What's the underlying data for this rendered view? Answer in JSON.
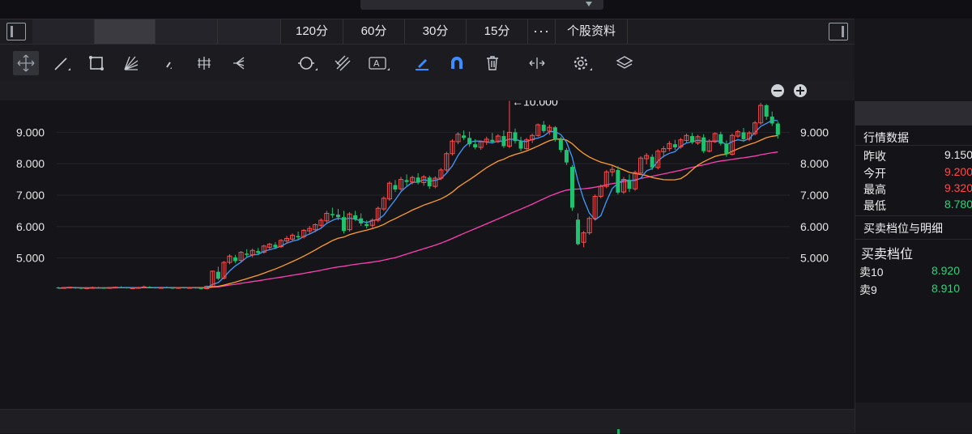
{
  "periods": {
    "p120": "120分",
    "p60": "60分",
    "p30": "30分",
    "p15": "15分",
    "more": "···",
    "profile": "个股资料"
  },
  "toolbar": {
    "tools": [
      "crosshair-icon",
      "line-icon",
      "rectangle-icon",
      "fan-icon",
      "arrow-icon",
      "channel-icon",
      "fib-icon",
      "cycle-icon",
      "pitchfork-icon",
      "text-icon",
      "pen-icon",
      "magnet-icon",
      "trash-icon",
      "measure-icon",
      "settings-icon",
      "layers-icon"
    ]
  },
  "chart_data": {
    "type": "candlestick",
    "y_ticks": [
      "9.000",
      "8.000",
      "7.000",
      "6.000",
      "5.000"
    ],
    "ylim": [
      4.0,
      10.0
    ],
    "annotation": "←10.000",
    "colors": {
      "up": "#ff4d4d",
      "down": "#1fc26e",
      "ma5": "#3f9cff",
      "ma20": "#ff9e2b",
      "ma60": "#ff3fb5"
    },
    "candles": [
      [
        4.06,
        4.08,
        4.02,
        4.04
      ],
      [
        4.05,
        4.07,
        4.02,
        4.06
      ],
      [
        4.05,
        4.08,
        4.03,
        4.07
      ],
      [
        4.06,
        4.08,
        4.02,
        4.04
      ],
      [
        4.05,
        4.06,
        4.01,
        4.03
      ],
      [
        4.04,
        4.07,
        4.02,
        4.05
      ],
      [
        4.05,
        4.09,
        4.03,
        4.06
      ],
      [
        4.06,
        4.08,
        4.03,
        4.05
      ],
      [
        4.05,
        4.07,
        4.02,
        4.04
      ],
      [
        4.04,
        4.07,
        4.02,
        4.06
      ],
      [
        4.06,
        4.09,
        4.04,
        4.07
      ],
      [
        4.07,
        4.1,
        4.04,
        4.06
      ],
      [
        4.06,
        4.08,
        4.03,
        4.05
      ],
      [
        4.05,
        4.07,
        4.02,
        4.05
      ],
      [
        4.05,
        4.08,
        4.03,
        4.06
      ],
      [
        4.06,
        4.12,
        4.04,
        4.08
      ],
      [
        4.08,
        4.1,
        4.04,
        4.06
      ],
      [
        4.06,
        4.08,
        4.03,
        4.05
      ],
      [
        4.05,
        4.08,
        4.03,
        4.06
      ],
      [
        4.06,
        4.09,
        4.04,
        4.05
      ],
      [
        4.05,
        4.07,
        4.02,
        4.04
      ],
      [
        4.04,
        4.07,
        4.02,
        4.06
      ],
      [
        4.06,
        4.08,
        4.03,
        4.05
      ],
      [
        4.05,
        4.08,
        4.03,
        4.06
      ],
      [
        4.06,
        4.08,
        4.03,
        4.04
      ],
      [
        4.04,
        4.06,
        4.0,
        4.02
      ],
      [
        4.02,
        4.12,
        4.0,
        4.1
      ],
      [
        4.1,
        4.6,
        4.08,
        4.58
      ],
      [
        4.56,
        4.72,
        4.3,
        4.34
      ],
      [
        4.36,
        4.9,
        4.32,
        4.86
      ],
      [
        4.86,
        5.12,
        4.8,
        5.06
      ],
      [
        5.02,
        5.1,
        4.84,
        4.9
      ],
      [
        4.92,
        5.22,
        4.88,
        5.18
      ],
      [
        5.14,
        5.28,
        5.02,
        5.1
      ],
      [
        5.1,
        5.3,
        5.02,
        5.24
      ],
      [
        5.22,
        5.32,
        5.1,
        5.16
      ],
      [
        5.18,
        5.42,
        5.14,
        5.38
      ],
      [
        5.34,
        5.48,
        5.26,
        5.44
      ],
      [
        5.42,
        5.5,
        5.28,
        5.34
      ],
      [
        5.36,
        5.6,
        5.32,
        5.56
      ],
      [
        5.54,
        5.7,
        5.46,
        5.62
      ],
      [
        5.6,
        5.78,
        5.54,
        5.72
      ],
      [
        5.7,
        5.84,
        5.58,
        5.66
      ],
      [
        5.68,
        5.92,
        5.62,
        5.88
      ],
      [
        5.86,
        6.02,
        5.78,
        5.94
      ],
      [
        5.9,
        6.1,
        5.82,
        6.06
      ],
      [
        6.04,
        6.26,
        5.98,
        6.2
      ],
      [
        6.18,
        6.5,
        6.1,
        6.42
      ],
      [
        6.4,
        6.6,
        6.28,
        6.36
      ],
      [
        6.38,
        6.56,
        6.2,
        6.3
      ],
      [
        6.3,
        6.5,
        5.78,
        5.86
      ],
      [
        5.9,
        6.46,
        5.84,
        6.4
      ],
      [
        6.36,
        6.5,
        6.18,
        6.24
      ],
      [
        6.26,
        6.42,
        6.02,
        6.1
      ],
      [
        6.08,
        6.2,
        5.94,
        6.02
      ],
      [
        6.04,
        6.26,
        5.96,
        6.2
      ],
      [
        6.2,
        6.64,
        6.14,
        6.58
      ],
      [
        6.56,
        6.96,
        6.5,
        6.9
      ],
      [
        6.88,
        7.44,
        6.82,
        7.38
      ],
      [
        7.32,
        7.48,
        7.1,
        7.18
      ],
      [
        7.2,
        7.58,
        7.14,
        7.5
      ],
      [
        7.48,
        7.66,
        7.3,
        7.42
      ],
      [
        7.42,
        7.62,
        7.34,
        7.56
      ],
      [
        7.56,
        7.7,
        7.34,
        7.4
      ],
      [
        7.4,
        7.64,
        7.3,
        7.58
      ],
      [
        7.56,
        7.62,
        7.2,
        7.28
      ],
      [
        7.28,
        7.6,
        7.22,
        7.54
      ],
      [
        7.54,
        7.86,
        7.48,
        7.8
      ],
      [
        7.8,
        8.38,
        7.74,
        8.32
      ],
      [
        8.32,
        8.78,
        8.26,
        8.72
      ],
      [
        8.7,
        9.0,
        8.62,
        8.94
      ],
      [
        8.9,
        9.06,
        8.76,
        8.82
      ],
      [
        8.82,
        9.02,
        8.54,
        8.62
      ],
      [
        8.62,
        8.78,
        8.46,
        8.52
      ],
      [
        8.52,
        8.74,
        8.44,
        8.7
      ],
      [
        8.7,
        8.86,
        8.6,
        8.78
      ],
      [
        8.76,
        8.98,
        8.64,
        8.7
      ],
      [
        8.7,
        8.94,
        8.66,
        8.88
      ],
      [
        8.88,
        9.06,
        8.5,
        8.56
      ],
      [
        8.56,
        10.0,
        8.5,
        9.0
      ],
      [
        9.0,
        9.12,
        8.64,
        8.72
      ],
      [
        8.72,
        8.86,
        8.4,
        8.48
      ],
      [
        8.48,
        8.82,
        8.44,
        8.76
      ],
      [
        8.76,
        8.96,
        8.66,
        8.9
      ],
      [
        8.9,
        9.28,
        8.86,
        9.24
      ],
      [
        9.24,
        9.36,
        8.98,
        9.04
      ],
      [
        9.04,
        9.24,
        8.92,
        9.16
      ],
      [
        9.16,
        9.2,
        8.7,
        8.76
      ],
      [
        8.76,
        8.86,
        8.36,
        8.44
      ],
      [
        8.44,
        8.5,
        7.96,
        8.04
      ],
      [
        7.9,
        7.96,
        6.5,
        6.6
      ],
      [
        6.22,
        6.42,
        5.4,
        5.44
      ],
      [
        5.5,
        5.86,
        5.34,
        5.8
      ],
      [
        5.8,
        6.32,
        5.74,
        6.26
      ],
      [
        6.26,
        7.02,
        6.2,
        6.96
      ],
      [
        6.96,
        7.34,
        6.9,
        7.28
      ],
      [
        7.28,
        7.8,
        7.22,
        7.74
      ],
      [
        7.74,
        7.92,
        7.6,
        7.82
      ],
      [
        7.8,
        7.92,
        7.02,
        7.08
      ],
      [
        7.1,
        7.58,
        7.04,
        7.5
      ],
      [
        7.48,
        7.66,
        7.1,
        7.2
      ],
      [
        7.2,
        7.78,
        7.14,
        7.72
      ],
      [
        7.7,
        8.24,
        7.64,
        8.18
      ],
      [
        8.16,
        8.34,
        7.98,
        8.26
      ],
      [
        8.22,
        8.3,
        7.8,
        7.88
      ],
      [
        7.88,
        8.46,
        7.82,
        8.4
      ],
      [
        8.38,
        8.56,
        8.2,
        8.48
      ],
      [
        8.48,
        8.72,
        8.4,
        8.64
      ],
      [
        8.62,
        8.76,
        8.44,
        8.52
      ],
      [
        8.54,
        8.82,
        8.48,
        8.76
      ],
      [
        8.74,
        8.96,
        8.66,
        8.9
      ],
      [
        8.88,
        8.98,
        8.62,
        8.68
      ],
      [
        8.66,
        8.92,
        8.6,
        8.86
      ],
      [
        8.84,
        8.94,
        8.34,
        8.4
      ],
      [
        8.4,
        8.78,
        8.36,
        8.72
      ],
      [
        8.7,
        9.0,
        8.66,
        8.96
      ],
      [
        8.94,
        9.02,
        8.58,
        8.64
      ],
      [
        8.64,
        8.74,
        8.22,
        8.3
      ],
      [
        8.3,
        8.96,
        8.26,
        8.9
      ],
      [
        8.88,
        9.08,
        8.82,
        9.02
      ],
      [
        9.0,
        9.14,
        8.7,
        8.78
      ],
      [
        8.78,
        9.04,
        8.72,
        8.98
      ],
      [
        8.96,
        9.36,
        8.9,
        9.3
      ],
      [
        9.3,
        9.94,
        9.24,
        9.86
      ],
      [
        9.86,
        9.9,
        9.4,
        9.5
      ],
      [
        9.5,
        9.66,
        9.2,
        9.28
      ],
      [
        9.28,
        9.34,
        8.8,
        8.92
      ]
    ]
  },
  "sidebar": {
    "section_market": "行情数据",
    "prev_close_label": "昨收",
    "prev_close_value": "9.150",
    "open_label": "今开",
    "open_value": "9.200",
    "high_label": "最高",
    "high_value": "9.320",
    "low_label": "最低",
    "low_value": "8.780",
    "book_detail_title": "买卖档位与明细",
    "book_title": "买卖档位",
    "ask10_label": "卖10",
    "ask10_value": "8.920",
    "ask9_label": "卖9",
    "ask9_value": "8.910"
  }
}
